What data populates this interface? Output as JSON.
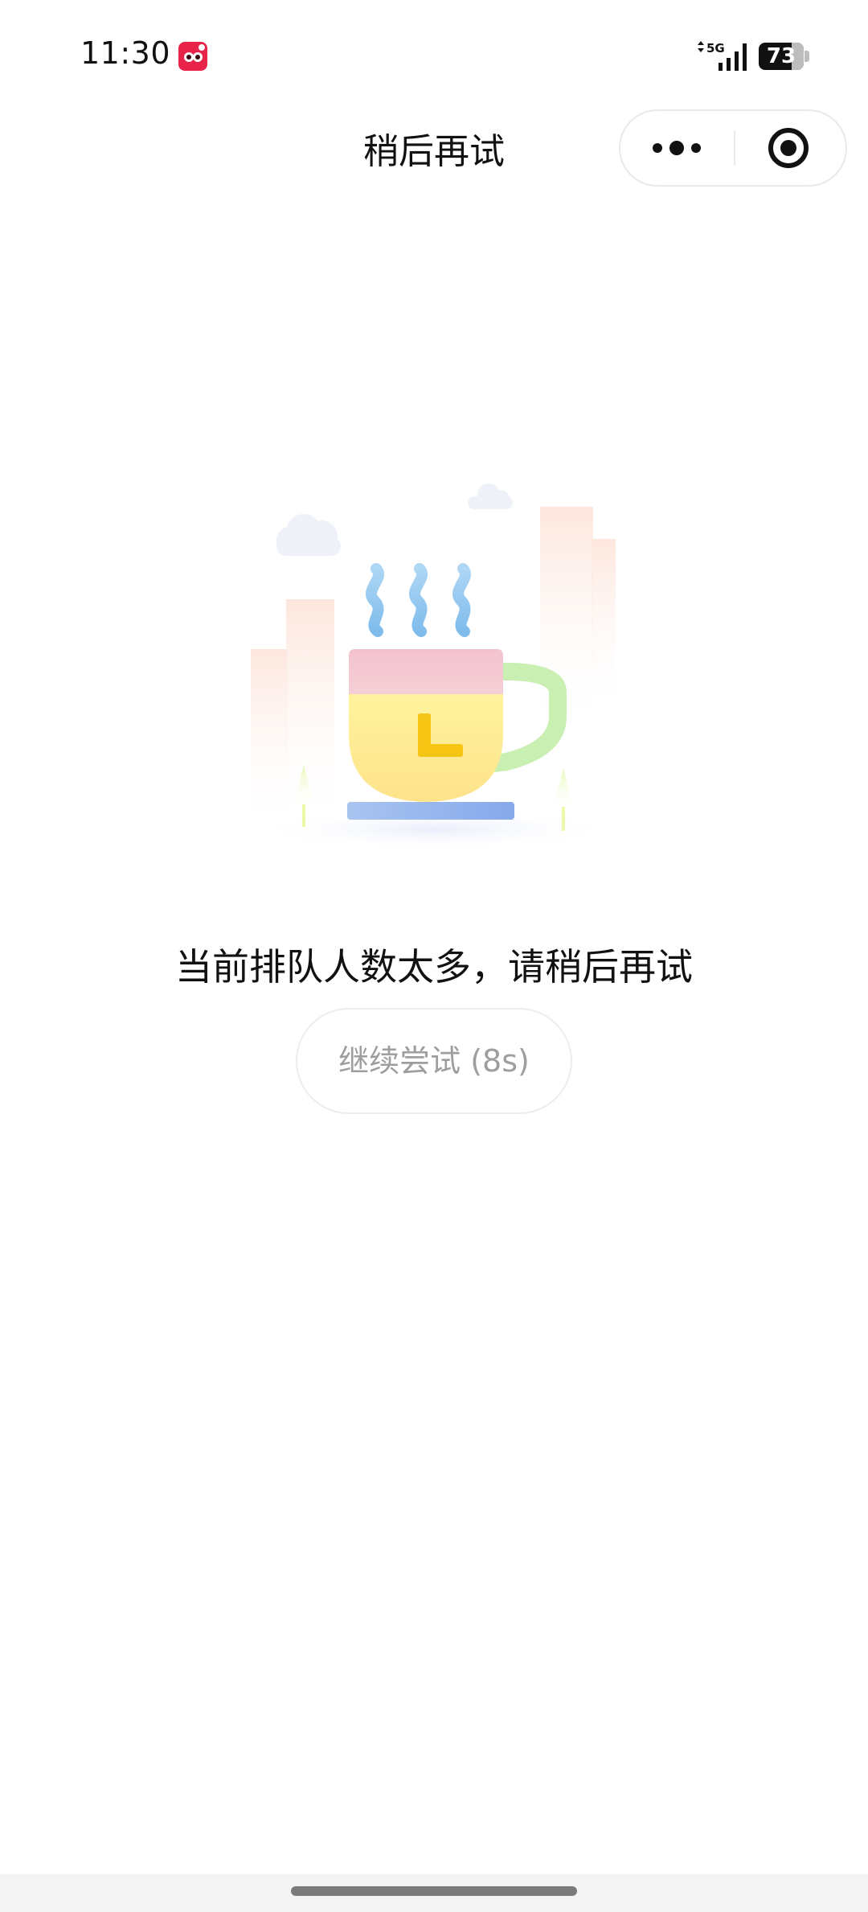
{
  "status_bar": {
    "time": "11:30",
    "network": "5G",
    "battery_level": "73",
    "battery_fraction": 0.73,
    "app_icon": "red-app-notification-icon",
    "signal_icon": "signal-bars-icon"
  },
  "nav": {
    "title": "稍后再试",
    "more_icon": "more-dots-icon",
    "close_icon": "target-close-icon"
  },
  "illustration": {
    "icon": "coffee-cup-clock-illustration"
  },
  "main": {
    "message": "当前排队人数太多，请稍后再试",
    "retry_label": "继续尝试 (8s)"
  },
  "colors": {
    "text_primary": "#111111",
    "button_text": "#9e9e9e",
    "cup_yellow": "#fff09a",
    "cup_pink": "#f6c7d1",
    "steam_blue": "#8ec5ef",
    "handle_green": "#c8efb0",
    "saucer_blue": "#8fb1ee",
    "clock_hand": "#f5c518"
  }
}
